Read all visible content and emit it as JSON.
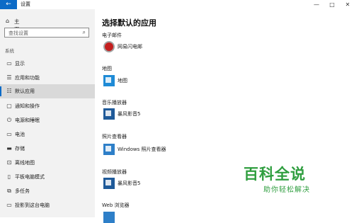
{
  "window": {
    "title": "设置",
    "back_glyph": "←",
    "minimize_glyph": "—",
    "maximize_glyph": "□",
    "close_glyph": "✕"
  },
  "sidebar": {
    "home_label": "主页",
    "search_placeholder": "查找设置",
    "section_label": "系统",
    "items": [
      {
        "label": "显示",
        "icon": "display-icon",
        "glyph": "▭"
      },
      {
        "label": "应用和功能",
        "icon": "apps-icon",
        "glyph": "☰"
      },
      {
        "label": "默认应用",
        "icon": "default-apps-icon",
        "glyph": "☷",
        "selected": true
      },
      {
        "label": "通知和操作",
        "icon": "notifications-icon",
        "glyph": "▢"
      },
      {
        "label": "电源和睡眠",
        "icon": "power-icon",
        "glyph": "⏻"
      },
      {
        "label": "电池",
        "icon": "battery-icon",
        "glyph": "▭"
      },
      {
        "label": "存储",
        "icon": "storage-icon",
        "glyph": "▬"
      },
      {
        "label": "离线地图",
        "icon": "offline-maps-icon",
        "glyph": "⊡"
      },
      {
        "label": "平板电脑模式",
        "icon": "tablet-mode-icon",
        "glyph": "▯"
      },
      {
        "label": "多任务",
        "icon": "multitasking-icon",
        "glyph": "⧉"
      },
      {
        "label": "投影到这台电脑",
        "icon": "project-icon",
        "glyph": "▭"
      }
    ]
  },
  "main": {
    "title": "选择默认的应用",
    "categories": [
      {
        "label": "电子邮件",
        "app": "网易闪电邮",
        "app_icon": "mail-app-icon"
      },
      {
        "label": "地图",
        "app": "地图",
        "app_icon": "maps-app-icon"
      },
      {
        "label": "音乐播放器",
        "app": "暴风影音5",
        "app_icon": "music-player-icon"
      },
      {
        "label": "照片查看器",
        "app": "Windows 照片查看器",
        "app_icon": "photo-viewer-icon"
      },
      {
        "label": "视频播放器",
        "app": "暴风影音5",
        "app_icon": "video-player-icon"
      },
      {
        "label": "Web 浏览器",
        "app": "",
        "app_icon": "browser-icon"
      }
    ]
  },
  "watermark": {
    "title": "百科全说",
    "subtitle": "助你轻松解决"
  },
  "colors": {
    "accent": "#0c6bc7",
    "sidebar_bg": "#f2f2f2",
    "selected_bg": "#d9d9d9",
    "watermark": "#2f9e3f"
  }
}
